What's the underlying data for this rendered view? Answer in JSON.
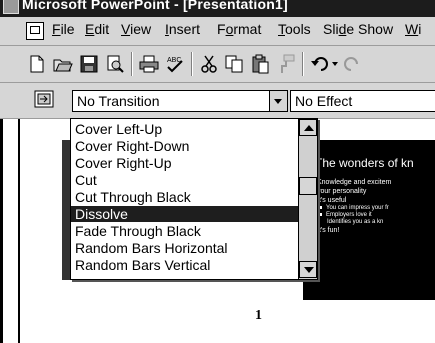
{
  "window": {
    "title": "Microsoft PowerPoint - [Presentation1]"
  },
  "menubar": {
    "items": [
      {
        "label": "File",
        "mnemonic": "F",
        "rest": "ile"
      },
      {
        "label": "Edit",
        "mnemonic": "E",
        "rest": "dit"
      },
      {
        "label": "View",
        "mnemonic": "V",
        "rest": "iew"
      },
      {
        "label": "Insert",
        "mnemonic": "I",
        "rest": "nsert"
      },
      {
        "label": "Format",
        "pre": "F",
        "mnemonic": "o",
        "rest": "rmat"
      },
      {
        "label": "Tools",
        "mnemonic": "T",
        "rest": "ools"
      },
      {
        "label": "Slide Show",
        "pre": "Sli",
        "mnemonic": "d",
        "rest": "e Show"
      },
      {
        "label": "Wi",
        "mnemonic": "W",
        "rest": "i"
      }
    ]
  },
  "toolbar": {
    "icons": [
      "new-icon",
      "open-icon",
      "save-icon",
      "print-preview-icon",
      "print-icon",
      "spelling-icon",
      "cut-icon",
      "copy-icon",
      "paste-icon",
      "format-painter-icon",
      "undo-icon",
      "redo-icon"
    ]
  },
  "slide_sorter": {
    "transition_value": "No Transition",
    "effect_value": "No Effect"
  },
  "transition_list": {
    "options": [
      "Cover Left-Up",
      "Cover Right-Down",
      "Cover Right-Up",
      "Cut",
      "Cut Through Black",
      "Dissolve",
      "Fade Through Black",
      "Random Bars Horizontal",
      "Random Bars Vertical"
    ],
    "selected": "Dissolve"
  },
  "slide": {
    "title": "The wonders of kn",
    "bullets": [
      {
        "level": 1,
        "text": "Knowledge and excitem"
      },
      {
        "level": 1,
        "text": "your personality",
        "continuation": true
      },
      {
        "level": 1,
        "text": "It's useful"
      },
      {
        "level": 2,
        "text": "You can impress your fr"
      },
      {
        "level": 2,
        "text": "Employers love it"
      },
      {
        "level": 2,
        "text": "Identifies you as a kn",
        "continuation": true
      },
      {
        "level": 1,
        "text": "It's fun!"
      }
    ],
    "number": "1"
  },
  "colors": {
    "selection": "#1e1e1e",
    "chrome": "#d6d6d6",
    "slide_bg": "#000000"
  }
}
